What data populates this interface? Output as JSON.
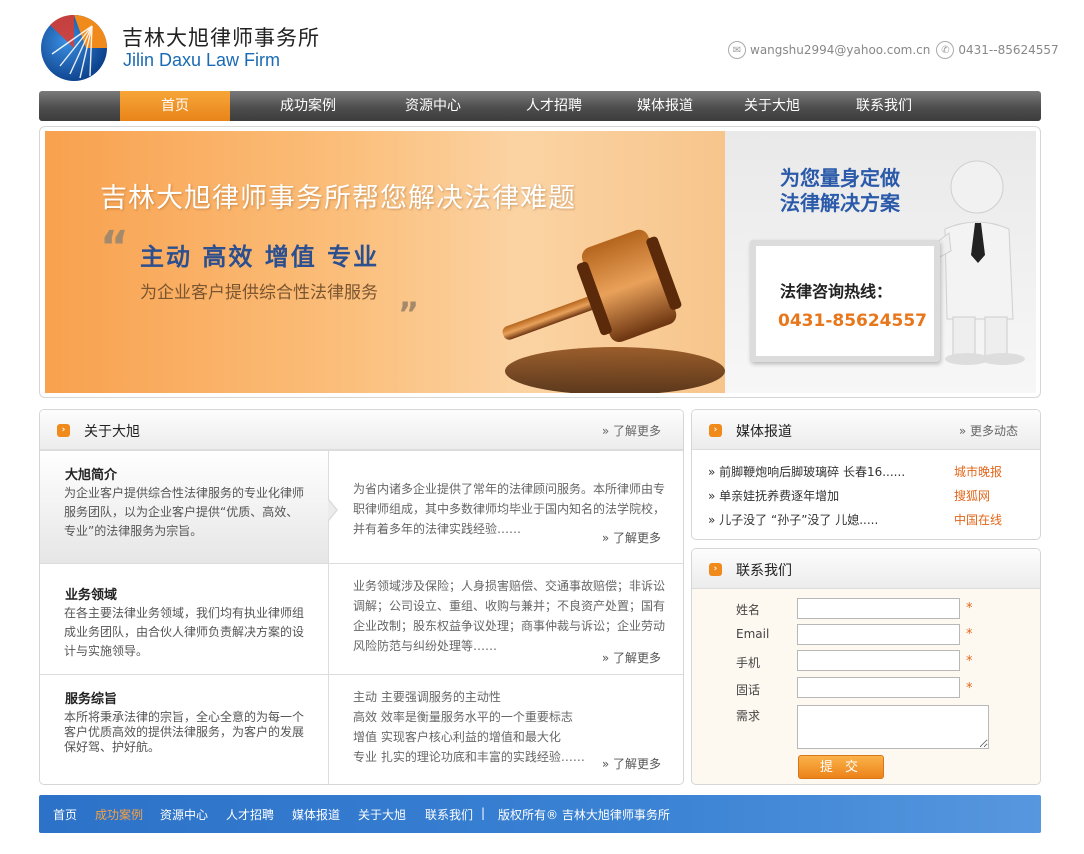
{
  "brand": {
    "cn_name": "吉林大旭律师事务所",
    "en_name": "Jilin Daxu Law Firm"
  },
  "header_contact": {
    "email": "wangshu2994@yahoo.com.cn",
    "phone": "0431--85624557",
    "email_icon": "mail-icon",
    "phone_icon": "phone-icon"
  },
  "nav": {
    "items": [
      {
        "label": "首页",
        "active": true
      },
      {
        "label": "成功案例"
      },
      {
        "label": "资源中心"
      },
      {
        "label": "人才招聘"
      },
      {
        "label": "媒体报道"
      },
      {
        "label": "关于大旭"
      },
      {
        "label": "联系我们"
      }
    ]
  },
  "banner": {
    "title": "吉林大旭律师事务所帮您解决法律难题",
    "slogan": "主动  高效  增值  专业",
    "subtitle": "为企业客户提供综合性法律服务",
    "right_line1": "为您量身定做",
    "right_line2": "法律解决方案",
    "hotline_label": "法律咨询热线：",
    "hotline_number": "0431-85624557"
  },
  "about": {
    "title": "关于大旭",
    "more": "» 了解更多",
    "sections": [
      {
        "heading": "大旭简介",
        "summary": "为企业客户提供综合性法律服务的专业化律师服务团队，以为企业客户提供“优质、高效、专业”的法律服务为宗旨。",
        "detail": "为省内诸多企业提供了常年的法律顾问服务。本所律师由专职律师组成，其中多数律师均毕业于国内知名的法学院校，并有着多年的法律实践经验……",
        "more": "» 了解更多"
      },
      {
        "heading": "业务领域",
        "summary": "在各主要法律业务领域，我们均有执业律师组成业务团队，由合伙人律师负责解决方案的设计与实施领导。",
        "detail": "业务领域涉及保险；人身损害赔偿、交通事故赔偿；非诉讼调解；公司设立、重组、收购与兼并；不良资产处置；国有企业改制；股东权益争议处理；商事仲裁与诉讼；企业劳动风险防范与纠纷处理等……",
        "more": "» 了解更多"
      },
      {
        "heading": "服务综旨",
        "summary": "本所将秉承法律的宗旨，全心全意的为每一个客户优质高效的提供法律服务，为客户的发展保好驾、护好航。",
        "detail_lines": [
          "主动  主要强调服务的主动性",
          "高效  效率是衡量服务水平的一个重要标志",
          "增值  实现客户核心利益的增值和最大化",
          "专业  扎实的理论功底和丰富的实践经验……"
        ],
        "more": "» 了解更多"
      }
    ]
  },
  "media": {
    "title": "媒体报道",
    "more": "» 更多动态",
    "items": [
      {
        "title": "»  前脚鞭炮响后脚玻璃碎 长春16......",
        "source": "城市晚报"
      },
      {
        "title": "»  单亲娃抚养费逐年增加",
        "source": "搜狐网"
      },
      {
        "title": "»  儿子没了 “孙子”没了 儿媳.....",
        "source": "中国在线"
      }
    ]
  },
  "contact_form": {
    "title": "联系我们",
    "fields": [
      {
        "label": "姓名",
        "required": "*"
      },
      {
        "label": "Email",
        "required": "*"
      },
      {
        "label": "手机",
        "required": "*"
      },
      {
        "label": "固话",
        "required": "*"
      }
    ],
    "textarea_label": "需求",
    "submit": "提 交"
  },
  "footer": {
    "links": [
      "首页",
      "成功案例",
      "资源中心",
      "人才招聘",
      "媒体报道",
      "关于大旭",
      "联系我们"
    ],
    "highlight": "成功案例",
    "separator": "|",
    "copyright": "版权所有® 吉林大旭律师事务所"
  },
  "colors": {
    "accent": "#f08a1a",
    "nav_bg": "#4e4e4e",
    "footer_bg": "#2c72c8",
    "brand_blue": "#1a6bb5",
    "source_orange": "#e2661a"
  }
}
